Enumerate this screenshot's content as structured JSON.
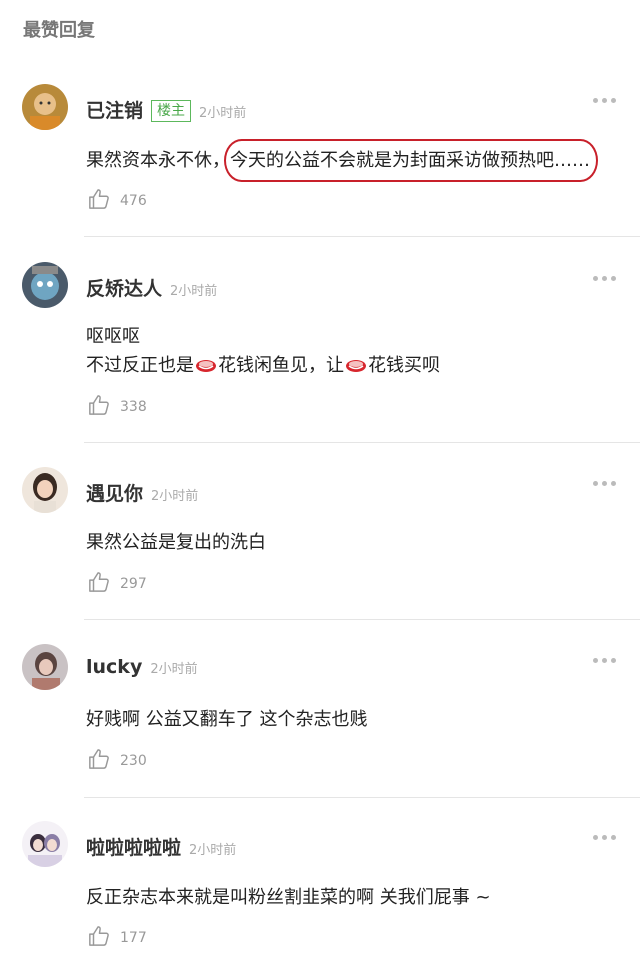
{
  "section_title": "最赞回复",
  "comments": [
    {
      "username": "已注销",
      "badge": "楼主",
      "time": "2小时前",
      "text_prefix": "果然资本永不休，",
      "text_highlight": "今天的公益不会就是为封面采访做预热吧……",
      "likes": "476",
      "more_icon": "more-dots-icon"
    },
    {
      "username": "反矫达人",
      "time": "2小时前",
      "line1": "呕呕呕",
      "line2_a": "不过反正也是",
      "line2_b": "花钱闲鱼见，让",
      "line2_c": "花钱买呗",
      "likes": "338"
    },
    {
      "username": "遇见你",
      "time": "2小时前",
      "text": "果然公益是复出的洗白",
      "likes": "297"
    },
    {
      "username": "lucky",
      "time": "2小时前",
      "text": "好贱啊 公益又翻车了 这个杂志也贱",
      "likes": "230"
    },
    {
      "username": "啦啦啦啦啦",
      "time": "2小时前",
      "text": "反正杂志本来就是叫粉丝割韭菜的啊 关我们屁事 ~",
      "likes": "177"
    }
  ],
  "colors": {
    "highlight_box": "#c8202a",
    "badge": "#5cb85c"
  }
}
